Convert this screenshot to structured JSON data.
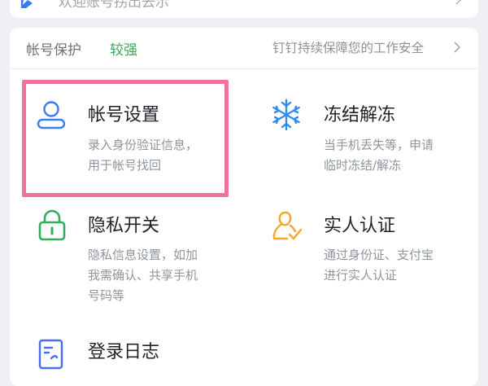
{
  "top_card": {
    "text": "欢迎账号拐出去示"
  },
  "security": {
    "title": "帐号保护",
    "level": "较强",
    "link": "钉钉持续保障您的工作安全",
    "link_chevron_icon": "chevron-right-icon"
  },
  "items": [
    {
      "name": "帐号设置",
      "desc_line1": "录入身份验证信息，",
      "desc_line2": "用于帐号找回",
      "desc_line3": "",
      "icon": "user-icon",
      "color": "#3a7bf6"
    },
    {
      "name": "冻结解冻",
      "desc_line1": "当手机丢失等，申请",
      "desc_line2": "临时冻结/解冻",
      "desc_line3": "",
      "icon": "snowflake-icon",
      "color": "#2f8cf0"
    },
    {
      "name": "隐私开关",
      "desc_line1": "隐私信息设置，如加",
      "desc_line2": "我需确认、共享手机",
      "desc_line3": "号码等",
      "icon": "lock-icon",
      "color": "#2fae5b"
    },
    {
      "name": "实人认证",
      "desc_line1": "通过身份证、支付宝",
      "desc_line2": "进行实人认证",
      "desc_line3": "",
      "icon": "user-check-icon",
      "color": "#f5a623"
    },
    {
      "name": "登录日志",
      "desc_line1": "",
      "desc_line2": "",
      "desc_line3": "",
      "icon": "document-icon",
      "color": "#4b6cf0"
    }
  ],
  "highlight_color": "#f0719a"
}
